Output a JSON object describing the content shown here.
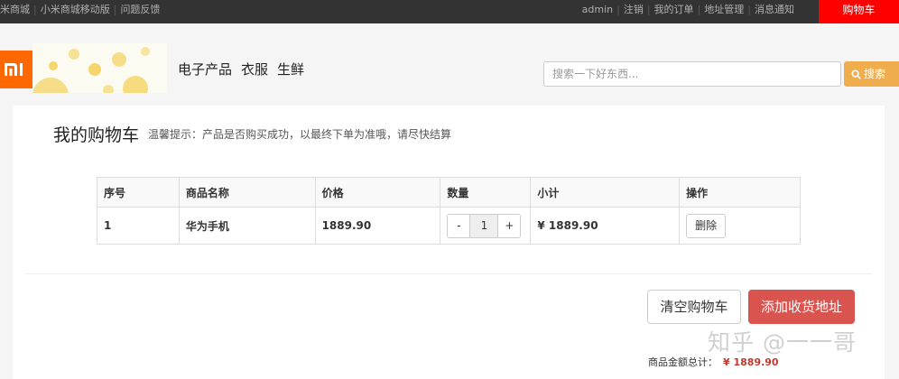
{
  "topbar": {
    "links_left": [
      "米商城",
      "小米商城移动版",
      "问题反馈"
    ],
    "links_right": [
      "admin",
      "注销",
      "我的订单",
      "地址管理",
      "消息通知"
    ],
    "cart_label": "购物车",
    "cart_color": "#ff0000"
  },
  "header": {
    "logo_color": "#ff6700",
    "nav": [
      "电子产品",
      "衣服",
      "生鲜"
    ],
    "search_placeholder": "搜索一下好东西...",
    "search_button": "搜索",
    "search_button_color": "#f0ad4e"
  },
  "cart": {
    "title": "我的购物车",
    "tip": "温馨提示：产品是否购买成功，以最终下单为准哦，请尽快结算",
    "columns": [
      "序号",
      "商品名称",
      "价格",
      "数量",
      "小计",
      "操作"
    ],
    "rows": [
      {
        "index": "1",
        "name": "华为手机",
        "price": "1889.90",
        "quantity": "1",
        "subtotal": "¥ 1889.90",
        "action": "删除"
      }
    ],
    "qty_minus": "-",
    "qty_plus": "+",
    "clear_button": "清空购物车",
    "add_address_button": "添加收货地址",
    "add_address_color": "#d9534f",
    "total_label": "商品金额总计：",
    "total_value": "¥   1889.90"
  },
  "watermark": "知乎 @一一哥"
}
